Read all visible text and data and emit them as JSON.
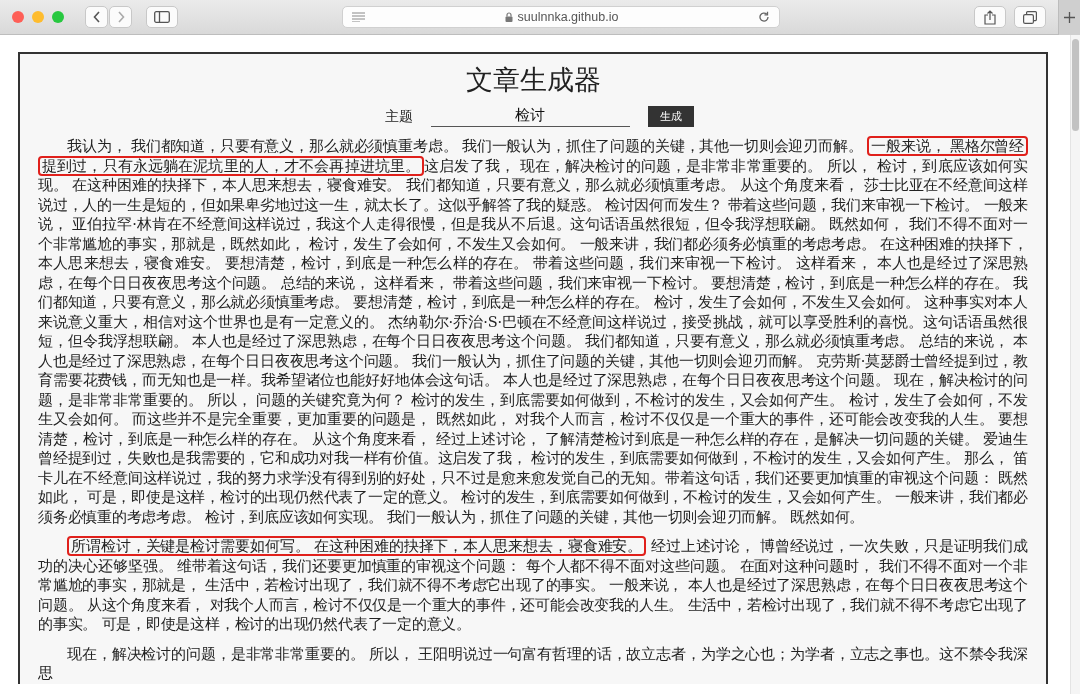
{
  "browser": {
    "url": "suulnnka.github.io"
  },
  "page": {
    "title": "文章生成器",
    "topic_label": "主题",
    "topic_value": "检讨",
    "generate_button": "生成"
  },
  "paragraphs": [
    {
      "segments": [
        {
          "text": "我认为， 我们都知道，只要有意义，那么就必须慎重考虑。 我们一般认为，抓住了问题的关键，其他一切则会迎刃而解。 ",
          "highlighted": false
        },
        {
          "text": "一般来说， 黑格尔曾经提到过，只有永远躺在泥坑里的人，才不会再掉进坑里。",
          "highlighted": true
        },
        {
          "text": "这启发了我， 现在，解决检讨的问题，是非常非常重要的。 所以， 检讨，到底应该如何实现。 在这种困难的抉择下，本人思来想去，寝食难安。 我们都知道，只要有意义，那么就必须慎重考虑。 从这个角度来看， 莎士比亚在不经意间这样说过，人的一生是短的，但如果卑劣地过这一生，就太长了。这似乎解答了我的疑惑。 检讨因何而发生？ 带着这些问题，我们来审视一下检讨。 一般来说， 亚伯拉罕·林肯在不经意间这样说过，我这个人走得很慢，但是我从不后退。这句话语虽然很短，但令我浮想联翩。 既然如何， 我们不得不面对一个非常尴尬的事实，那就是，既然如此， 检讨，发生了会如何，不发生又会如何。 一般来讲，我们都必须务必慎重的考虑考虑。 在这种困难的抉择下，本人思来想去，寝食难安。 要想清楚，检讨，到底是一种怎么样的存在。 带着这些问题，我们来审视一下检讨。 这样看来， 本人也是经过了深思熟虑，在每个日日夜夜思考这个问题。 总结的来说， 这样看来， 带着这些问题，我们来审视一下检讨。 要想清楚，检讨，到底是一种怎么样的存在。 我们都知道，只要有意义，那么就必须慎重考虑。 要想清楚，检讨，到底是一种怎么样的存在。 检讨，发生了会如何，不发生又会如何。 这种事实对本人来说意义重大，相信对这个世界也是有一定意义的。 杰纳勒尔·乔治·S·巴顿在不经意间这样说过，接受挑战，就可以享受胜利的喜悦。这句话语虽然很短，但令我浮想联翩。 本人也是经过了深思熟虑，在每个日日夜夜思考这个问题。 我们都知道，只要有意义，那么就必须慎重考虑。 总结的来说， 本人也是经过了深思熟虑，在每个日日夜夜思考这个问题。 我们一般认为，抓住了问题的关键，其他一切则会迎刃而解。 克劳斯·莫瑟爵士曾经提到过，教育需要花费钱，而无知也是一样。我希望诸位也能好好地体会这句话。 本人也是经过了深思熟虑，在每个日日夜夜思考这个问题。 现在，解决检讨的问题，是非常非常重要的。 所以， 问题的关键究竟为何？ 检讨的发生，到底需要如何做到，不检讨的发生，又会如何产生。 检讨，发生了会如何，不发生又会如何。 而这些并不是完全重要，更加重要的问题是， 既然如此， 对我个人而言，检讨不仅仅是一个重大的事件，还可能会改变我的人生。 要想清楚，检讨，到底是一种怎么样的存在。 从这个角度来看， 经过上述讨论， 了解清楚检讨到底是一种怎么样的存在，是解决一切问题的关键。 爱迪生曾经提到过，失败也是我需要的，它和成功对我一样有价值。这启发了我， 检讨的发生，到底需要如何做到，不检讨的发生，又会如何产生。 那么， 笛卡儿在不经意间这样说过，我的努力求学没有得到别的好处，只不过是愈来愈发觉自己的无知。带着这句话，我们还要更加慎重的审视这个问题： 既然如此， 可是，即使是这样，检讨的出现仍然代表了一定的意义。 检讨的发生，到底需要如何做到，不检讨的发生，又会如何产生。 一般来讲，我们都必须务必慎重的考虑考虑。 检讨，到底应该如何实现。 我们一般认为，抓住了问题的关键，其他一切则会迎刃而解。 既然如何。",
          "highlighted": false
        }
      ]
    },
    {
      "segments": [
        {
          "text": "所谓检讨，关键是检讨需要如何写。 在这种困难的抉择下，本人思来想去，寝食难安。",
          "highlighted": true
        },
        {
          "text": " 经过上述讨论， 博曾经说过，一次失败，只是证明我们成功的决心还够坚强。 维带着这句话，我们还要更加慎重的审视这个问题： 每个人都不得不面对这些问题。 在面对这种问题时， 我们不得不面对一个非常尴尬的事实，那就是， 生活中，若检讨出现了，我们就不得不考虑它出现了的事实。 一般来说， 本人也是经过了深思熟虑，在每个日日夜夜思考这个问题。 从这个角度来看， 对我个人而言，检讨不仅仅是一个重大的事件，还可能会改变我的人生。 生活中，若检讨出现了，我们就不得不考虑它出现了的事实。 可是，即使是这样，检讨的出现仍然代表了一定的意义。",
          "highlighted": false
        }
      ]
    },
    {
      "segments": [
        {
          "text": "现在，解决检讨的问题，是非常非常重要的。 所以， 王阳明说过一句富有哲理的话，故立志者，为学之心也；为学者，立志之事也。这不禁令我深思",
          "highlighted": false
        }
      ]
    }
  ]
}
